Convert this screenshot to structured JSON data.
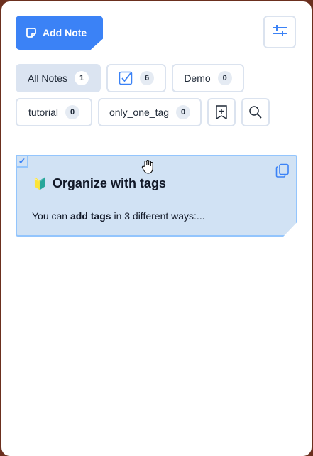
{
  "header": {
    "add_note_label": "Add Note",
    "add_note_icon": "note-icon",
    "settings_icon": "sliders-icon"
  },
  "filters": [
    {
      "label": "All Notes",
      "count": "1",
      "active": true
    },
    {
      "icon": "checkbox-icon",
      "count": "6"
    },
    {
      "label": "Demo",
      "count": "0"
    },
    {
      "label": "tutorial",
      "count": "0"
    },
    {
      "label": "only_one_tag",
      "count": "0"
    }
  ],
  "toolbar": {
    "add_tag_icon": "bookmark-plus-icon",
    "search_icon": "search-icon"
  },
  "note": {
    "title_emoji": "🔰",
    "title": "Organize with tags",
    "body_prefix": "You can ",
    "body_bold": "add tags",
    "body_suffix": " in 3 different ways:..."
  },
  "colors": {
    "accent": "#3b82f6",
    "note_bg": "#d1e2f4",
    "note_border": "#93c5fd",
    "window_border": "#6b2f1e"
  }
}
